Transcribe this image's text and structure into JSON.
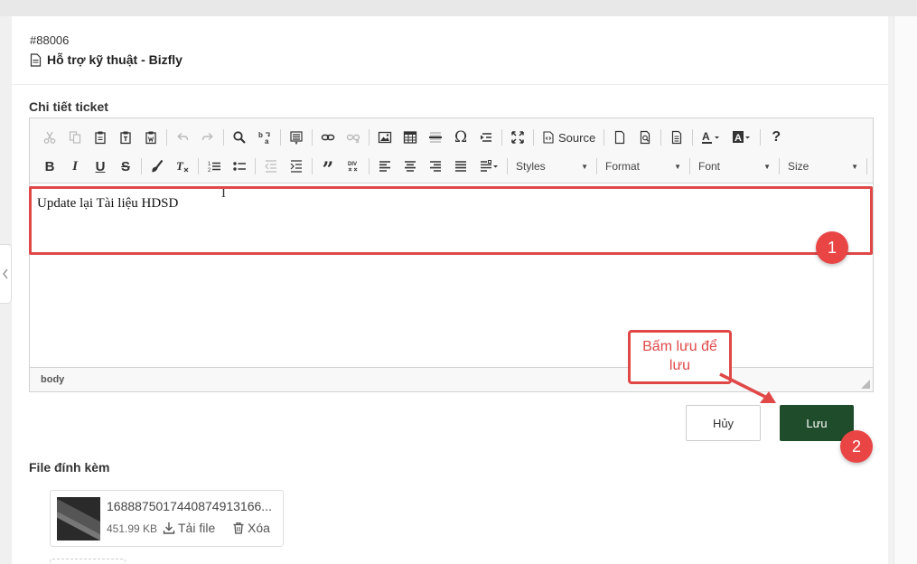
{
  "ticket": {
    "id": "#88006",
    "title": "Hỗ trợ kỹ thuật - Bizfly"
  },
  "details_label": "Chi tiết ticket",
  "editor": {
    "toolbar": {
      "source_label": "Source",
      "styles_label": "Styles",
      "format_label": "Format",
      "font_label": "Font",
      "size_label": "Size"
    },
    "content": "Update lại Tài liệu HDSD",
    "status_path": "body"
  },
  "annotations": {
    "badge_1": "1",
    "badge_2": "2",
    "callout_text": "Bấm lưu để lưu",
    "color": "#e04848"
  },
  "actions": {
    "cancel_label": "Hủy",
    "save_label": "Lưu",
    "save_color": "#1f4d2b"
  },
  "attachments": {
    "label": "File đính kèm",
    "files": [
      {
        "name": "1688875017440874913166...",
        "size": "451.99 KB",
        "download_label": "Tải file",
        "delete_label": "Xóa"
      }
    ]
  }
}
